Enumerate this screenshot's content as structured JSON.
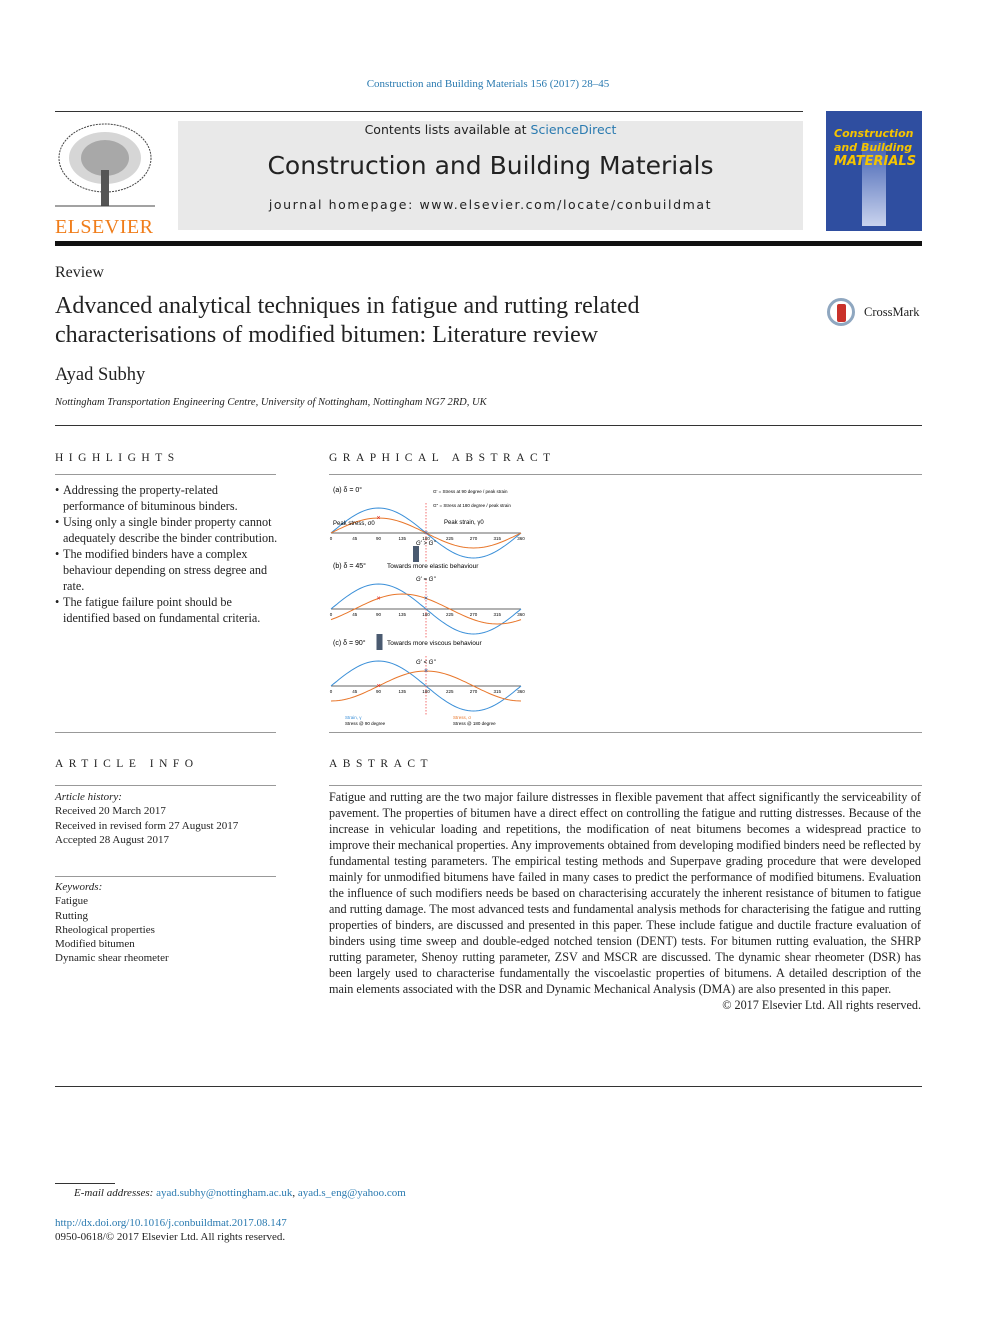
{
  "citation": "Construction and Building Materials 156 (2017) 28–45",
  "header": {
    "contents_prefix": "Contents lists available at ",
    "contents_link": "ScienceDirect",
    "journal_title": "Construction and Building Materials",
    "homepage": "journal homepage: www.elsevier.com/locate/conbuildmat",
    "publisher_logo": "ELSEVIER",
    "cover_title": [
      "Construction",
      "and Building",
      "MATERIALS"
    ]
  },
  "article": {
    "type": "Review",
    "title_lines": [
      "Advanced analytical techniques in fatigue and rutting related",
      "characterisations of modified bitumen: Literature review"
    ],
    "author": "Ayad Subhy",
    "affiliation": "Nottingham Transportation Engineering Centre, University of Nottingham, Nottingham NG7 2RD, UK",
    "crossmark": "CrossMark"
  },
  "highlights": {
    "heading": "HIGHLIGHTS",
    "items": [
      "Addressing the property-related performance of bituminous binders.",
      "Using only a single binder property cannot adequately describe the binder contribution.",
      "The modified binders have a complex behaviour depending on stress degree and rate.",
      "The fatigue failure point should be identified based on fundamental criteria."
    ]
  },
  "graphical_abstract": {
    "heading": "GRAPHICAL ABSTRACT"
  },
  "chart_data": {
    "type": "line",
    "x_ticks": [
      0,
      45,
      90,
      135,
      180,
      225,
      270,
      315,
      360
    ],
    "panels": [
      {
        "label": "(a)  δ = 0°",
        "phase_deg": 0,
        "note": "",
        "relation": "G' > G''"
      },
      {
        "label": "(b)  δ = 45°",
        "phase_deg": 45,
        "note": "Towards more elastic behaviour",
        "relation": "G' = G''"
      },
      {
        "label": "(c)  δ = 90°",
        "phase_deg": 90,
        "note": "Towards more viscous behaviour",
        "relation": "G' < G''"
      }
    ],
    "annotations": [
      "Peak stress, σ0",
      "Peak strain, γ0",
      "G' = Stress at 90 degree / peak strain",
      "G'' = Stress at 180 degree / peak strain"
    ],
    "series": [
      {
        "name": "Strain, γ",
        "color": "#3a8fd8",
        "amplitude": 1
      },
      {
        "name": "Stress, σ",
        "color": "#e8762a",
        "amplitude": 0.6
      }
    ],
    "markers": [
      "Stress @ 90 degree",
      "Stress @ 180 degree"
    ]
  },
  "article_info": {
    "heading": "ARTICLE INFO",
    "history_label": "Article history:",
    "history": [
      "Received 20 March 2017",
      "Received in revised form 27 August 2017",
      "Accepted 28 August 2017"
    ],
    "keywords_label": "Keywords:",
    "keywords": [
      "Fatigue",
      "Rutting",
      "Rheological properties",
      "Modified bitumen",
      "Dynamic shear rheometer"
    ]
  },
  "abstract": {
    "heading": "ABSTRACT",
    "text": "Fatigue and rutting are the two major failure distresses in flexible pavement that affect significantly the serviceability of pavement. The properties of bitumen have a direct effect on controlling the fatigue and rutting distresses. Because of the increase in vehicular loading and repetitions, the modification of neat bitumens becomes a widespread practice to improve their mechanical properties. Any improvements obtained from developing modified binders need be reflected by fundamental testing parameters. The empirical testing methods and Superpave grading procedure that were developed mainly for unmodified bitumens have failed in many cases to predict the performance of modified bitumens. Evaluation the influence of such modifiers needs be based on characterising accurately the inherent resistance of bitumen to fatigue and rutting damage. The most advanced tests and fundamental analysis methods for characterising the fatigue and rutting properties of binders, are discussed and presented in this paper. These include fatigue and ductile fracture evaluation of binders using time sweep and double-edged notched tension (DENT) tests. For bitumen rutting evaluation, the SHRP rutting parameter, Shenoy rutting parameter, ZSV and MSCR are discussed. The dynamic shear rheometer (DSR) has been largely used to characterise fundamentally the viscoelastic properties of bitumens. A detailed description of the main elements associated with the DSR and Dynamic Mechanical Analysis (DMA) are also presented in this paper.",
    "copyright": "© 2017 Elsevier Ltd. All rights reserved."
  },
  "footer": {
    "email_label": "E-mail addresses: ",
    "email1": "ayad.subhy@nottingham.ac.uk",
    "email2": "ayad.s_eng@yahoo.com",
    "doi": "http://dx.doi.org/10.1016/j.conbuildmat.2017.08.147",
    "issn": "0950-0618/© 2017 Elsevier Ltd. All rights reserved."
  },
  "colors": {
    "link": "#2a7ab0",
    "elsevier_orange": "#f07d1a",
    "cover_blue": "#2f4ea0",
    "cover_yellow": "#f5c400",
    "header_gray": "#e9e9e9"
  }
}
